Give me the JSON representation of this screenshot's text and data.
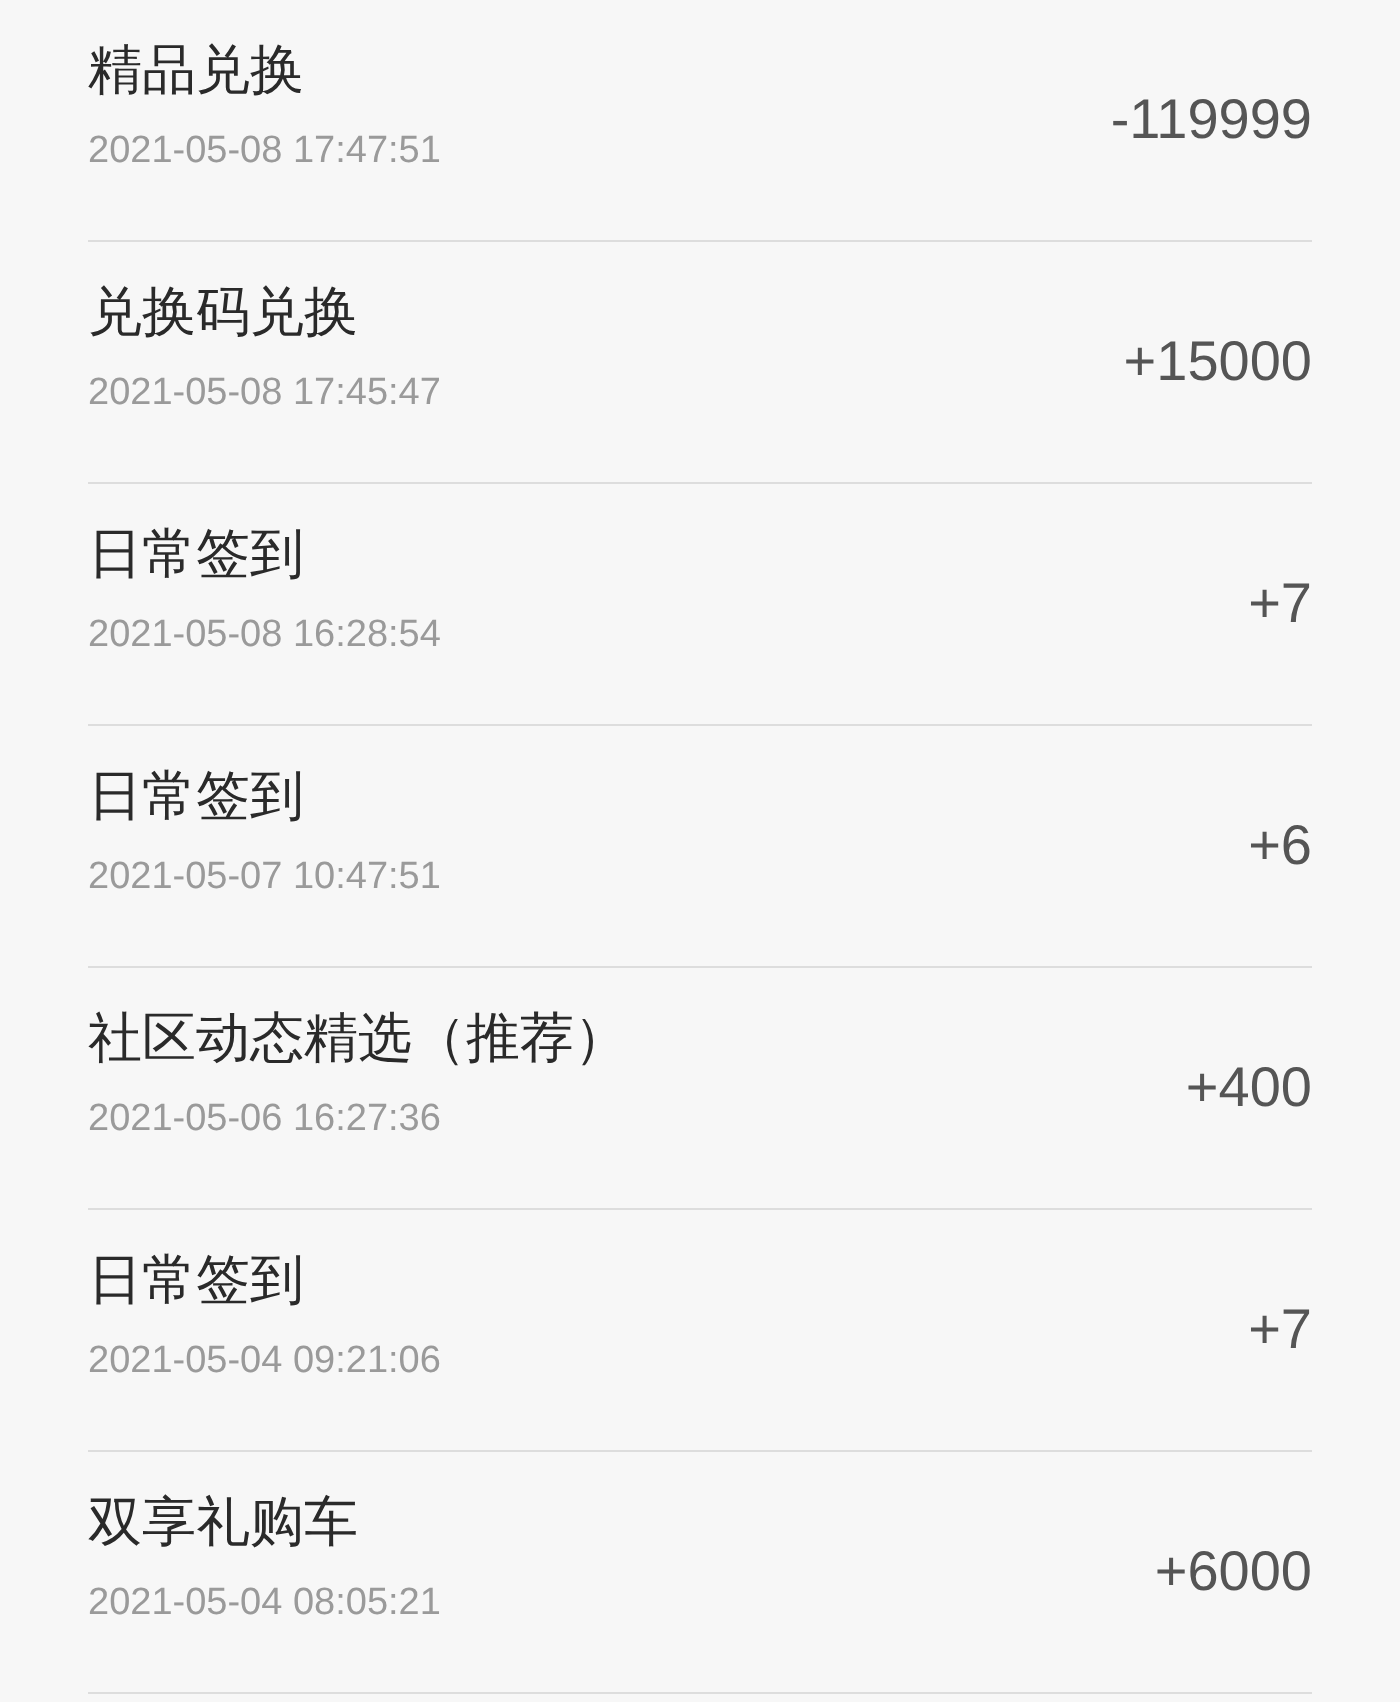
{
  "records": [
    {
      "title": "精品兑换",
      "time": "2021-05-08 17:47:51",
      "amount": "-119999"
    },
    {
      "title": "兑换码兑换",
      "time": "2021-05-08 17:45:47",
      "amount": "+15000"
    },
    {
      "title": "日常签到",
      "time": "2021-05-08 16:28:54",
      "amount": "+7"
    },
    {
      "title": "日常签到",
      "time": "2021-05-07 10:47:51",
      "amount": "+6"
    },
    {
      "title": "社区动态精选（推荐）",
      "time": "2021-05-06 16:27:36",
      "amount": "+400"
    },
    {
      "title": "日常签到",
      "time": "2021-05-04 09:21:06",
      "amount": "+7"
    },
    {
      "title": "双享礼购车",
      "time": "2021-05-04 08:05:21",
      "amount": "+6000"
    }
  ]
}
